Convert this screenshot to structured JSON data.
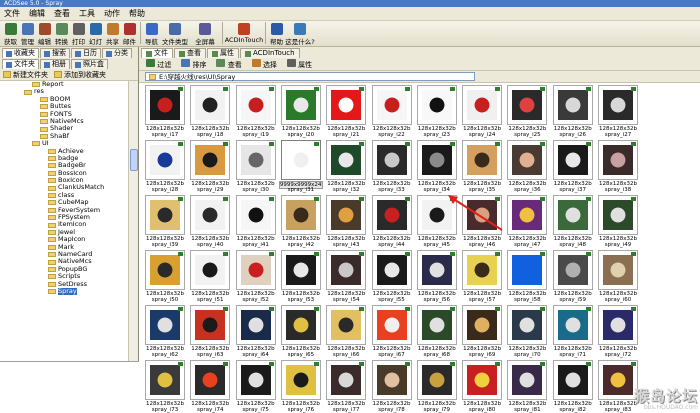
{
  "window": {
    "title": "ACDSee 5.0 - Spray"
  },
  "menu": [
    "文件",
    "编辑",
    "查看",
    "工具",
    "动作",
    "帮助"
  ],
  "toolbar": [
    {
      "label": "获取",
      "icon": "acquire-icon",
      "color": "#3a7a3a"
    },
    {
      "label": "管理",
      "icon": "manage-icon",
      "color": "#4a74b8"
    },
    {
      "label": "编辑",
      "icon": "edit-icon",
      "color": "#a04a2a"
    },
    {
      "label": "转换",
      "icon": "convert-icon",
      "color": "#5a8a5a"
    },
    {
      "label": "打印",
      "icon": "print-icon",
      "color": "#606060"
    },
    {
      "label": "幻灯",
      "icon": "slideshow-icon",
      "color": "#2a6aa8"
    },
    {
      "label": "共享",
      "icon": "share-icon",
      "color": "#c07a30"
    },
    {
      "label": "邮件",
      "icon": "email-icon",
      "color": "#b03030"
    },
    {
      "label": "导航",
      "icon": "navigate-icon",
      "color": "#3a6ac8"
    },
    {
      "label": "文件类型",
      "icon": "file-type-icon",
      "color": "#4a6aa8",
      "wide": true
    },
    {
      "label": "全屏幕",
      "icon": "fullscreen-icon",
      "color": "#5a5a9a",
      "wide": true
    },
    {
      "label": "ACDInTouch",
      "icon": "acdintouch-icon",
      "color": "#c04020",
      "xwide": true
    },
    {
      "label": "帮助",
      "icon": "help-icon",
      "color": "#2a5aa8"
    },
    {
      "label": "这是什么?",
      "icon": "whats-this-icon",
      "color": "#3a7ab8",
      "wide": true
    }
  ],
  "left": {
    "tabs1": [
      "收藏夹",
      "搜索",
      "日历",
      "分类"
    ],
    "tabs2": [
      "文件夹",
      "相册",
      "照片盒"
    ],
    "folder_buttons": [
      "新建文件夹",
      "添加到收藏夹"
    ],
    "tree": [
      {
        "label": "Report",
        "indent": 4
      },
      {
        "label": "res",
        "indent": 3
      },
      {
        "label": "BOOM",
        "indent": 5
      },
      {
        "label": "Buttes",
        "indent": 5
      },
      {
        "label": "FONTS",
        "indent": 5
      },
      {
        "label": "NativeMcs",
        "indent": 5
      },
      {
        "label": "Shader",
        "indent": 5
      },
      {
        "label": "ShaBf",
        "indent": 5
      },
      {
        "label": "UI",
        "indent": 4
      },
      {
        "label": "Achieve",
        "indent": 6
      },
      {
        "label": "badge",
        "indent": 6
      },
      {
        "label": "BadgeBr",
        "indent": 6
      },
      {
        "label": "BossIcon",
        "indent": 6
      },
      {
        "label": "BoxIcon",
        "indent": 6
      },
      {
        "label": "ClankUsMatch",
        "indent": 6
      },
      {
        "label": "class",
        "indent": 6
      },
      {
        "label": "CubeMap",
        "indent": 6
      },
      {
        "label": "FeverSystem",
        "indent": 6
      },
      {
        "label": "FPSystem",
        "indent": 6
      },
      {
        "label": "ItemIcon",
        "indent": 6
      },
      {
        "label": "Jewel",
        "indent": 6
      },
      {
        "label": "MapIcon",
        "indent": 6
      },
      {
        "label": "Mark",
        "indent": 6
      },
      {
        "label": "NameCard",
        "indent": 6
      },
      {
        "label": "NativeMcs",
        "indent": 6
      },
      {
        "label": "PopupBG",
        "indent": 6
      },
      {
        "label": "Scripts",
        "indent": 6
      },
      {
        "label": "SetDress",
        "indent": 6
      },
      {
        "label": "Spray",
        "indent": 6,
        "selected": true
      }
    ]
  },
  "right": {
    "tabs": [
      "文件",
      "查看",
      "属性",
      "ACDInTouch"
    ],
    "tools": [
      "过滤",
      "排序",
      "查看",
      "选择",
      "属性"
    ],
    "path": "E:\\穿越火线\\res\\UI\\Spray"
  },
  "thumbs": {
    "dims_label": "128x128x32b",
    "rows": [
      [
        {
          "name": "spray_i17",
          "bg": "#1a1a1a",
          "fg": "#c81e1e"
        },
        {
          "name": "spray_i18",
          "bg": "#f2f2f2",
          "fg": "#222222"
        },
        {
          "name": "spray_i19",
          "bg": "#f6f6f6",
          "fg": "#c81e1e"
        },
        {
          "name": "spray_i20",
          "bg": "#2a7a2a",
          "fg": "#e8e8e8"
        },
        {
          "name": "spray_i21",
          "bg": "#e41818",
          "fg": "#ffffff"
        },
        {
          "name": "spray_i22",
          "bg": "#f6f6f6",
          "fg": "#c81e1e"
        },
        {
          "name": "spray_i23",
          "bg": "#f8f8f8",
          "fg": "#111111"
        },
        {
          "name": "spray_i24",
          "bg": "#f0f0f0",
          "fg": "#c81e1e"
        },
        {
          "name": "spray_i25",
          "bg": "#2a2a2a",
          "fg": "#e04040"
        },
        {
          "name": "spray_i26",
          "bg": "#3a3a3a",
          "fg": "#d8d8d8"
        },
        {
          "name": "spray_i27",
          "bg": "#2a2a2a",
          "fg": "#d8d8d8"
        }
      ],
      [
        {
          "name": "spray_i28",
          "bg": "#f2f2f2",
          "fg": "#1a3a9a"
        },
        {
          "name": "spray_i29",
          "bg": "#d89a40",
          "fg": "#1a1a1a"
        },
        {
          "name": "spray_i30",
          "bg": "#e6e6e6",
          "fg": "#666666"
        },
        {
          "name": "spray_i31",
          "bg": "#ffffff",
          "fg": "#f0f0f0",
          "selected": true,
          "meta": "9999x9999x24b"
        },
        {
          "name": "spray_i32",
          "bg": "#1e4a2a",
          "fg": "#e8e8e8"
        },
        {
          "name": "spray_i33",
          "bg": "#2a2a2a",
          "fg": "#c8c8c8"
        },
        {
          "name": "spray_i34",
          "bg": "#1a1a1a",
          "fg": "#8a8a8a"
        },
        {
          "name": "spray_i35",
          "bg": "#d4a060",
          "fg": "#3a2a1a"
        },
        {
          "name": "spray_i36",
          "bg": "#4a3a34",
          "fg": "#e0b090"
        },
        {
          "name": "spray_i37",
          "bg": "#1a1a1a",
          "fg": "#e8e8e8"
        },
        {
          "name": "spray_i38",
          "bg": "#3a2a2a",
          "fg": "#c8a0a0"
        }
      ],
      [
        {
          "name": "spray_i39",
          "bg": "#e0c070",
          "fg": "#2a2a2a"
        },
        {
          "name": "spray_i40",
          "bg": "#f2f2f2",
          "fg": "#2a2a2a"
        },
        {
          "name": "spray_i41",
          "bg": "#f6f6f6",
          "fg": "#111111"
        },
        {
          "name": "spray_i42",
          "bg": "#c8a060",
          "fg": "#3a2a1a"
        },
        {
          "name": "spray_i43",
          "bg": "#4a3a2a",
          "fg": "#e0a040"
        },
        {
          "name": "spray_i44",
          "bg": "#2a2a2a",
          "fg": "#c82020"
        },
        {
          "name": "spray_i45",
          "bg": "#f2f2f2",
          "fg": "#1a1a1a"
        },
        {
          "name": "spray_i46",
          "bg": "#4a2a2a",
          "fg": "#d8a080"
        },
        {
          "name": "spray_i47",
          "bg": "#6a2a7a",
          "fg": "#f0c040"
        },
        {
          "name": "spray_i48",
          "bg": "#3a6a3a",
          "fg": "#e0e0e0"
        },
        {
          "name": "spray_i49",
          "bg": "#2a4a2a",
          "fg": "#e0e0e0"
        }
      ],
      [
        {
          "name": "spray_i50",
          "bg": "#d8a030",
          "fg": "#2a2a2a"
        },
        {
          "name": "spray_i51",
          "bg": "#f2f2f2",
          "fg": "#1a1a1a"
        },
        {
          "name": "spray_i52",
          "bg": "#e0d0c0",
          "fg": "#c82020"
        },
        {
          "name": "spray_i53",
          "bg": "#1a1a1a",
          "fg": "#e8e8e8"
        },
        {
          "name": "spray_i54",
          "bg": "#3a2a2a",
          "fg": "#c8c8c8"
        },
        {
          "name": "spray_i55",
          "bg": "#1a1a1a",
          "fg": "#e8e8e8"
        },
        {
          "name": "spray_i56",
          "bg": "#2a2a4a",
          "fg": "#e0e0e0"
        },
        {
          "name": "spray_i57",
          "bg": "#e8d050",
          "fg": "#3a2a1a"
        },
        {
          "name": "spray_i58",
          "bg": "#1060e0",
          "fg": "#1060e0"
        },
        {
          "name": "spray_i59",
          "bg": "#4a4a4a",
          "fg": "#b0b0b0"
        },
        {
          "name": "spray_i60",
          "bg": "#8a7050",
          "fg": "#e0d0b0"
        }
      ],
      [
        {
          "name": "spray_i62",
          "bg": "#1a3a6a",
          "fg": "#e0e0e0"
        },
        {
          "name": "spray_i63",
          "bg": "#c83020",
          "fg": "#1a1a1a"
        },
        {
          "name": "spray_i64",
          "bg": "#1a2a4a",
          "fg": "#e0e0e0"
        },
        {
          "name": "spray_i65",
          "bg": "#2a2a2a",
          "fg": "#e0c040"
        },
        {
          "name": "spray_i66",
          "bg": "#e0c060",
          "fg": "#2a2a2a"
        },
        {
          "name": "spray_i67",
          "bg": "#e84020",
          "fg": "#f0f0f0"
        },
        {
          "name": "spray_i68",
          "bg": "#2a4a2a",
          "fg": "#e0e0e0"
        },
        {
          "name": "spray_i69",
          "bg": "#3a2a1a",
          "fg": "#e0b060"
        },
        {
          "name": "spray_i70",
          "bg": "#2a3a4a",
          "fg": "#e0e0e0"
        },
        {
          "name": "spray_i71",
          "bg": "#1a6a8a",
          "fg": "#e0e0e0"
        },
        {
          "name": "spray_i72",
          "bg": "#2a2a6a",
          "fg": "#e0e0e0"
        }
      ],
      [
        {
          "name": "spray_i73",
          "bg": "#3a3a3a",
          "fg": "#e0c040"
        },
        {
          "name": "spray_i74",
          "bg": "#2a2a2a",
          "fg": "#e84020"
        },
        {
          "name": "spray_i75",
          "bg": "#1a1a1a",
          "fg": "#e0e0e0"
        },
        {
          "name": "spray_i76",
          "bg": "#e0c040",
          "fg": "#1a1a1a"
        },
        {
          "name": "spray_i77",
          "bg": "#3a2a2a",
          "fg": "#d8d8d8"
        },
        {
          "name": "spray_i78",
          "bg": "#4a3a2a",
          "fg": "#e0c0a0"
        },
        {
          "name": "spray_i79",
          "bg": "#2a2a2a",
          "fg": "#c8a040"
        },
        {
          "name": "spray_i80",
          "bg": "#c82020",
          "fg": "#f0d040"
        },
        {
          "name": "spray_i81",
          "bg": "#3a2a4a",
          "fg": "#e0e0e0"
        },
        {
          "name": "spray_i82",
          "bg": "#1a1a1a",
          "fg": "#e0e0e0"
        },
        {
          "name": "spray_i83",
          "bg": "#4a2a2a",
          "fg": "#f0c040"
        }
      ]
    ]
  },
  "watermark": {
    "title": "猴岛论坛",
    "url": "bbs.HOUDAO.com"
  }
}
